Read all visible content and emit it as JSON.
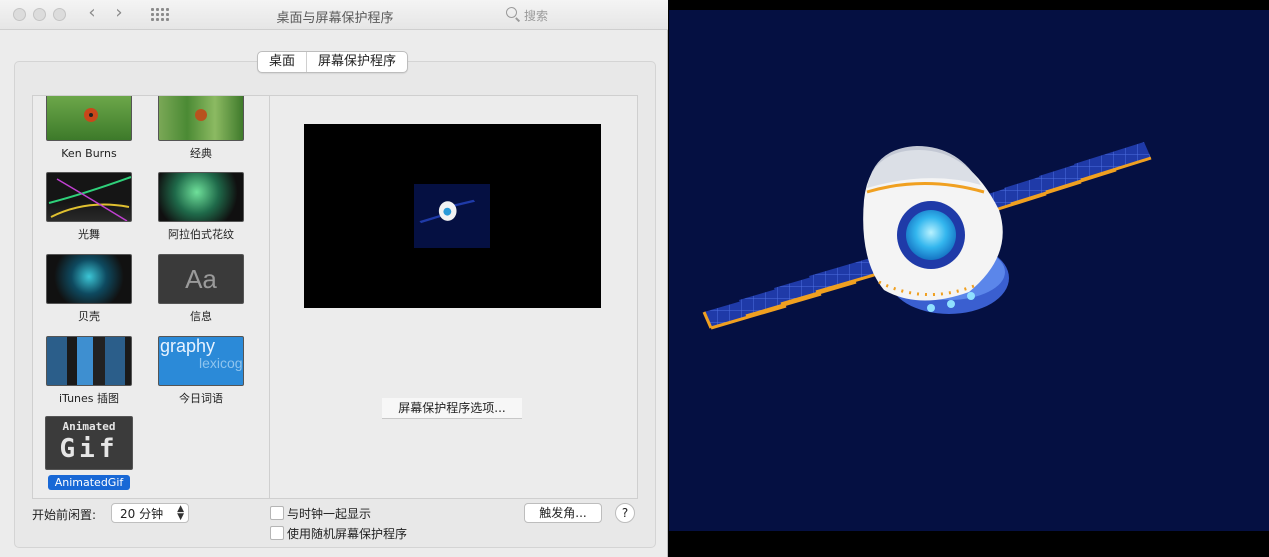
{
  "window": {
    "title": "桌面与屏幕保护程序",
    "search_placeholder": "搜索",
    "back_icon": "‹",
    "forward_icon": "›"
  },
  "tabs": [
    {
      "label": "桌面",
      "selected": false
    },
    {
      "label": "屏幕保护程序",
      "selected": true
    }
  ],
  "screensavers": [
    {
      "label": "Ken Burns",
      "icon": "ladybug-thumb"
    },
    {
      "label": "经典",
      "icon": "ladybug-grass-thumb"
    },
    {
      "label": "光舞",
      "icon": "flurry-thumb"
    },
    {
      "label": "阿拉伯式花纹",
      "icon": "arabesque-thumb"
    },
    {
      "label": "贝壳",
      "icon": "shell-thumb"
    },
    {
      "label": "信息",
      "icon": "message-thumb",
      "thumb_text": "Aa"
    },
    {
      "label": "iTunes 插图",
      "icon": "itunes-artwork-thumb"
    },
    {
      "label": "今日词语",
      "icon": "word-of-day-thumb",
      "thumb_text_1": "graphy",
      "thumb_text_2": "lexicog"
    },
    {
      "label": "AnimatedGif",
      "icon": "animated-gif-thumb",
      "selected": true,
      "thumb_text_1": "Animated",
      "thumb_text_2": "Gif"
    }
  ],
  "preview": {
    "options_button": "屏幕保护程序选项..."
  },
  "footer": {
    "idle_label": "开始前闲置:",
    "idle_value": "20 分钟",
    "show_clock_label": "与时钟一起显示",
    "show_clock_checked": false,
    "random_label": "使用随机屏幕保护程序",
    "random_checked": false,
    "hot_corners_button": "触发角...",
    "help_button": "?"
  },
  "colors": {
    "selection_blue": "#1868d6",
    "preview_background": "#051042",
    "panel_orange": "#f0a020",
    "panel_blue": "#1f3aa8"
  }
}
